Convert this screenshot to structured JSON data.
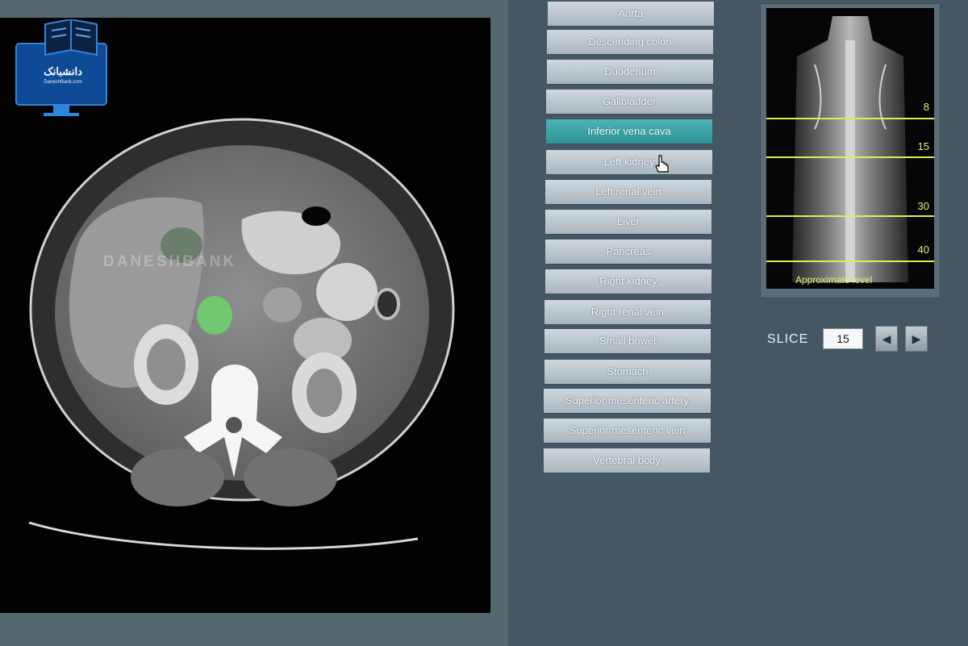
{
  "logo": {
    "text_fa": "دانشبانک",
    "text_en": "DaneshBank.com"
  },
  "viewer": {
    "watermark": "DANESHBANK"
  },
  "structures": [
    {
      "label": "Aorta",
      "selected": false
    },
    {
      "label": "Descending colon",
      "selected": false
    },
    {
      "label": "Duodenum",
      "selected": false
    },
    {
      "label": "Gallbladder",
      "selected": false
    },
    {
      "label": "Inferior vena cava",
      "selected": true
    },
    {
      "label": "Left kidney",
      "selected": false
    },
    {
      "label": "Left renal vein",
      "selected": false
    },
    {
      "label": "Liver",
      "selected": false
    },
    {
      "label": "Pancreas",
      "selected": false
    },
    {
      "label": "Right kidney",
      "selected": false
    },
    {
      "label": "Right renal vein",
      "selected": false
    },
    {
      "label": "Small bowel",
      "selected": false
    },
    {
      "label": "Stomach",
      "selected": false
    },
    {
      "label": "Superior mesenteric artery",
      "selected": false
    },
    {
      "label": "Superior mesenteric vein",
      "selected": false
    },
    {
      "label": "Vertebral body",
      "selected": false
    }
  ],
  "scout": {
    "levels": [
      "8",
      "15",
      "30",
      "40"
    ],
    "caption": "Approximate level"
  },
  "slice": {
    "label": "SLICE",
    "value": "15",
    "prev_icon": "arrow-left-icon",
    "next_icon": "arrow-right-icon"
  },
  "colors": {
    "selected_button": "#3aa3a5",
    "highlight_overlay": "#6fd46c",
    "scout_lines": "#e2ea5c"
  }
}
